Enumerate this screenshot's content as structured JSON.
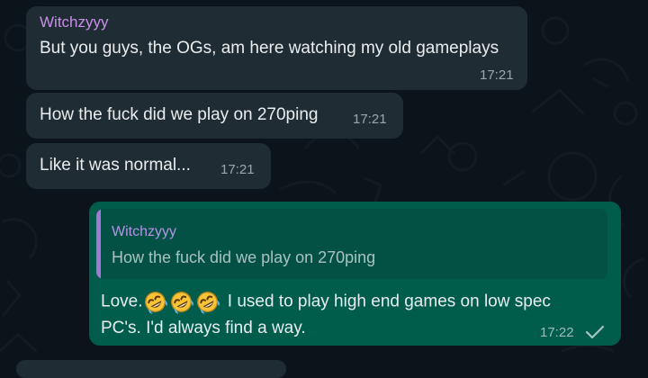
{
  "messages": [
    {
      "sender": "Witchzyyy",
      "text": "But you guys, the OGs, am here watching my old gameplays",
      "time": "17:21"
    },
    {
      "text": "How the fuck did we play on 270ping",
      "time": "17:21"
    },
    {
      "text": "Like it was normal...",
      "time": "17:21"
    }
  ],
  "reply": {
    "quoted_sender": "Witchzyyy",
    "quoted_text": "How the fuck did we play on 270ping",
    "prefix": "Love.",
    "emoji_icons": [
      "rolling-on-floor-laughing-icon",
      "rolling-on-floor-laughing-icon",
      "rolling-on-floor-laughing-icon"
    ],
    "text_line1": " I used to play high end games on low spec",
    "text_line2": "PC's. I'd always find a way.",
    "time": "17:22",
    "status_icon": "single-check-icon"
  },
  "colors": {
    "background": "#0b141a",
    "incoming_bubble": "#202c33",
    "outgoing_bubble": "#005c4b",
    "quote_background": "#025144",
    "sender_name": "#c88fe8",
    "quote_bar": "#a377d7"
  }
}
